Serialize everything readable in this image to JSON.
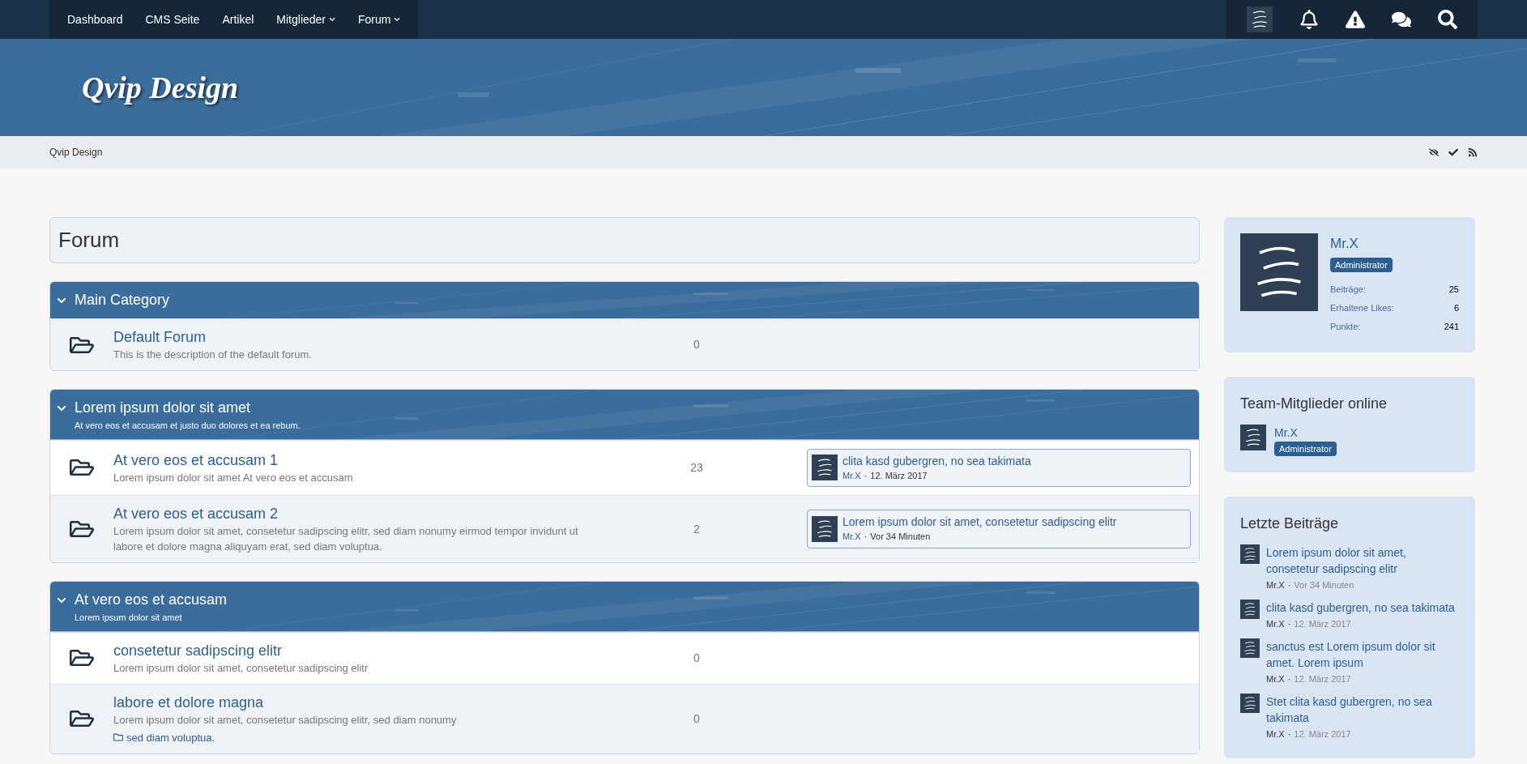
{
  "nav": {
    "items": [
      {
        "label": "Dashboard",
        "dropdown": false
      },
      {
        "label": "CMS Seite",
        "dropdown": false
      },
      {
        "label": "Artikel",
        "dropdown": false
      },
      {
        "label": "Mitglieder",
        "dropdown": true
      },
      {
        "label": "Forum",
        "dropdown": true
      }
    ]
  },
  "header": {
    "logo": "Qvip Design"
  },
  "breadcrumb": [
    "Qvip Design"
  ],
  "page_title": "Forum",
  "categories": [
    {
      "title": "Main Category",
      "expanded": true,
      "boards": [
        {
          "title": "Default Forum",
          "description": "This is the description of the default forum.",
          "count": "0",
          "shaded": true
        }
      ]
    },
    {
      "title": "Lorem ipsum dolor sit amet",
      "description": "At vero eos et accusam et justo duo dolores et ea rebum.",
      "expanded": true,
      "boards": [
        {
          "title": "At vero eos et accusam 1",
          "description": "Lorem ipsum dolor sit amet At vero eos et accusam",
          "count": "23",
          "shaded": false,
          "last_post": {
            "title": "clita kasd gubergren, no sea takimata",
            "author": "Mr.X",
            "separator": "·",
            "time": "12. März 2017"
          }
        },
        {
          "title": "At vero eos et accusam 2",
          "description": "Lorem ipsum dolor sit amet, consetetur sadipscing elitr, sed diam nonumy eirmod tempor invidunt ut labore et dolore magna aliquyam erat, sed diam voluptua.",
          "count": "2",
          "shaded": true,
          "last_post": {
            "title": "Lorem ipsum dolor sit amet, consetetur sadipscing elitr",
            "author": "Mr.X",
            "separator": "·",
            "time": "Vor 34 Minuten"
          }
        }
      ]
    },
    {
      "title": "At vero eos et accusam",
      "description": "Lorem ipsum dolor sit amet",
      "expanded": true,
      "boards": [
        {
          "title": "consetetur sadipscing elitr",
          "description": "Lorem ipsum dolor sit amet, consetetur sadipscing elitr",
          "count": "0",
          "shaded": false
        },
        {
          "title": "labore et dolore magna",
          "description": "Lorem ipsum dolor sit amet, consetetur sadipscing elitr, sed diam nonumy",
          "count": "0",
          "shaded": true,
          "subforums": [
            "sed diam voluptua."
          ]
        }
      ]
    }
  ],
  "profile": {
    "name": "Mr.X",
    "rank": "Administrator",
    "stats": [
      {
        "label": "Beiträge:",
        "value": "25"
      },
      {
        "label": "Erhaltene Likes:",
        "value": "6"
      },
      {
        "label": "Punkte:",
        "value": "241"
      }
    ]
  },
  "team_online": {
    "title": "Team-Mitglieder online",
    "members": [
      {
        "name": "Mr.X",
        "rank": "Administrator"
      }
    ]
  },
  "recent_posts": {
    "title": "Letzte Beiträge",
    "items": [
      {
        "title": "Lorem ipsum dolor sit amet, consetetur sadipscing elitr",
        "author": "Mr.X",
        "separator": "·",
        "time": "Vor 34 Minuten"
      },
      {
        "title": "clita kasd gubergren, no sea takimata",
        "author": "Mr.X",
        "separator": "·",
        "time": "12. März 2017"
      },
      {
        "title": "sanctus est Lorem ipsum dolor sit amet. Lorem ipsum",
        "author": "Mr.X",
        "separator": "·",
        "time": "12. März 2017"
      },
      {
        "title": "Stet clita kasd gubergren, no sea takimata",
        "author": "Mr.X",
        "separator": "·",
        "time": "12. März 2017"
      }
    ]
  }
}
